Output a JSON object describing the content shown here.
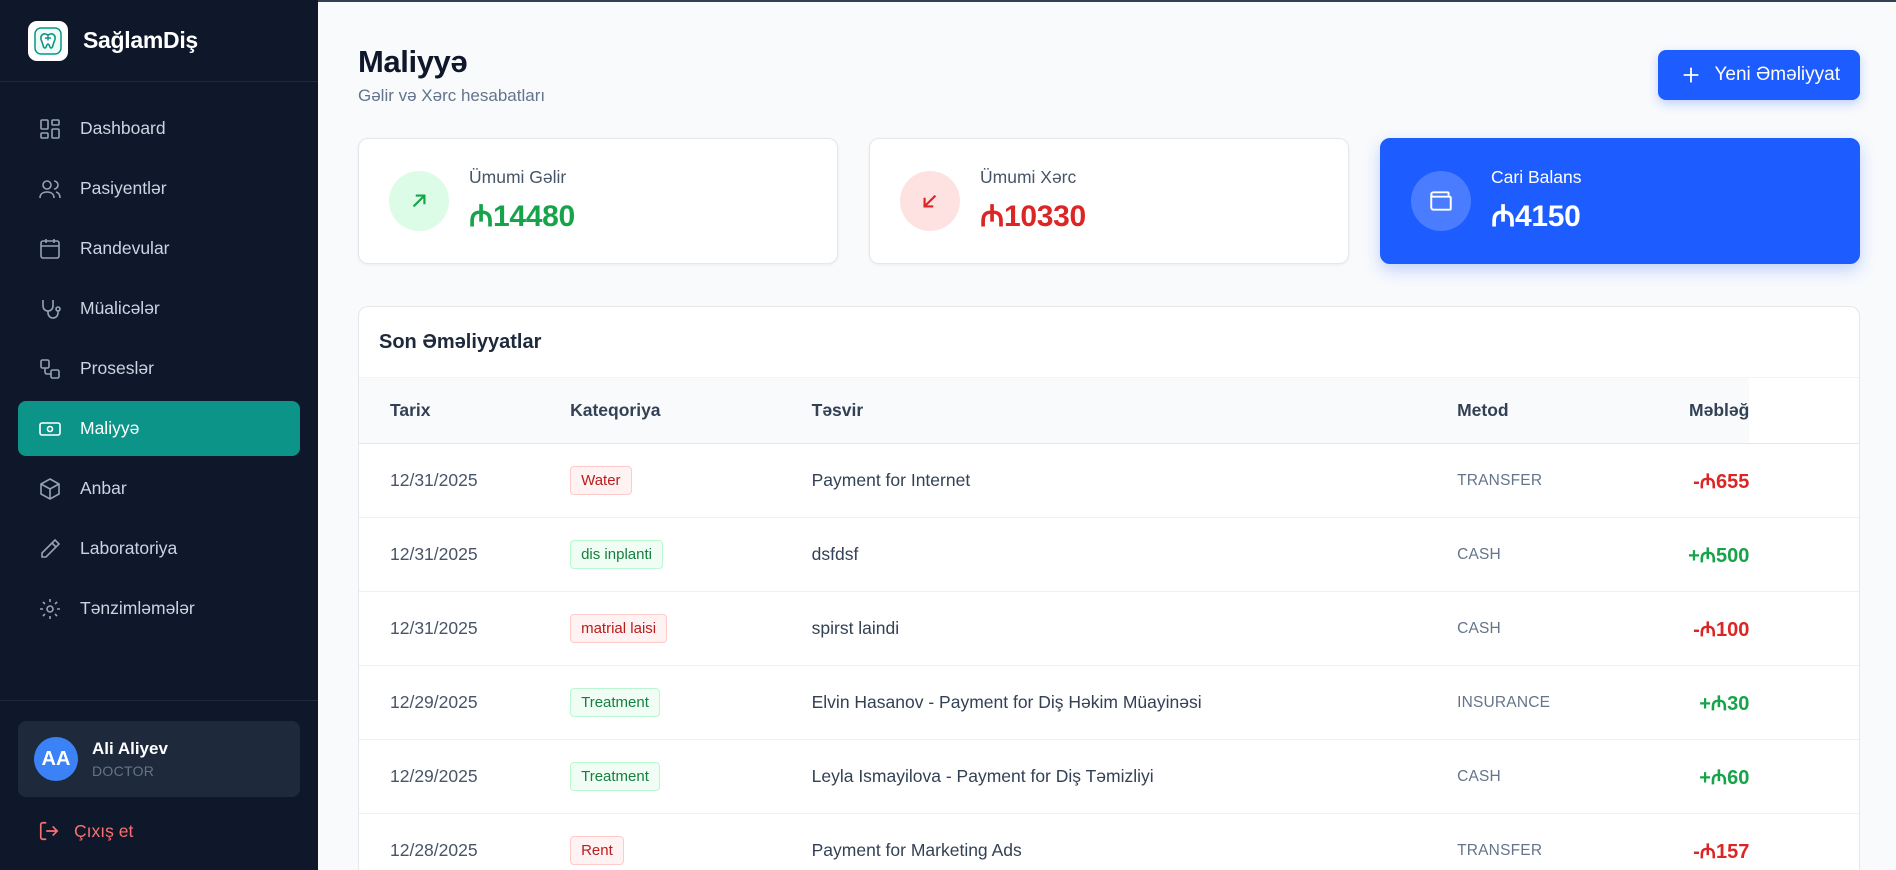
{
  "brand": {
    "name": "SağlamDiş"
  },
  "sidebar": {
    "items": [
      {
        "label": "Dashboard",
        "icon": "dashboard-icon",
        "active": false
      },
      {
        "label": "Pasiyentlər",
        "icon": "users-icon",
        "active": false
      },
      {
        "label": "Randevular",
        "icon": "calendar-icon",
        "active": false
      },
      {
        "label": "Müalicələr",
        "icon": "stethoscope-icon",
        "active": false
      },
      {
        "label": "Proseslər",
        "icon": "workflow-icon",
        "active": false
      },
      {
        "label": "Maliyyə",
        "icon": "banknote-icon",
        "active": true
      },
      {
        "label": "Anbar",
        "icon": "package-icon",
        "active": false
      },
      {
        "label": "Laboratoriya",
        "icon": "pen-icon",
        "active": false
      },
      {
        "label": "Tənzimləmələr",
        "icon": "gear-icon",
        "active": false
      }
    ],
    "user": {
      "initials": "AA",
      "name": "Ali Aliyev",
      "role": "DOCTOR"
    },
    "logout_label": "Çıxış et"
  },
  "header": {
    "title": "Maliyyə",
    "subtitle": "Gəlir və Xərc hesabatları",
    "new_button_label": "Yeni Əməliyyat"
  },
  "stats": {
    "income": {
      "label": "Ümumi Gəlir",
      "value": "₼14480"
    },
    "expense": {
      "label": "Ümumi Xərc",
      "value": "₼10330"
    },
    "balance": {
      "label": "Cari Balans",
      "value": "₼4150"
    }
  },
  "transactions": {
    "title": "Son Əməliyyatlar",
    "columns": {
      "date": "Tarix",
      "category": "Kateqoriya",
      "description": "Təsvir",
      "method": "Metod",
      "amount": "Məbləğ"
    },
    "rows": [
      {
        "date": "12/31/2025",
        "category": "Water",
        "type": "expense",
        "description": "Payment for Internet",
        "method": "TRANSFER",
        "amount": "-₼655"
      },
      {
        "date": "12/31/2025",
        "category": "dis inplanti",
        "type": "income",
        "description": "dsfdsf",
        "method": "CASH",
        "amount": "+₼500"
      },
      {
        "date": "12/31/2025",
        "category": "matrial laisi",
        "type": "expense",
        "description": "spirst laindi",
        "method": "CASH",
        "amount": "-₼100"
      },
      {
        "date": "12/29/2025",
        "category": "Treatment",
        "type": "income",
        "description": "Elvin Hasanov - Payment for Diş Həkim Müayinəsi",
        "method": "INSURANCE",
        "amount": "+₼30"
      },
      {
        "date": "12/29/2025",
        "category": "Treatment",
        "type": "income",
        "description": "Leyla Ismayilova - Payment for Diş Təmizliyi",
        "method": "CASH",
        "amount": "+₼60"
      },
      {
        "date": "12/28/2025",
        "category": "Rent",
        "type": "expense",
        "description": "Payment for Marketing Ads",
        "method": "TRANSFER",
        "amount": "-₼157"
      }
    ]
  },
  "colors": {
    "sidebar_bg": "#0f172a",
    "active_teal": "#0d9488",
    "primary_blue": "#1d5cff",
    "income_green": "#16a34a",
    "expense_red": "#dc2626"
  }
}
